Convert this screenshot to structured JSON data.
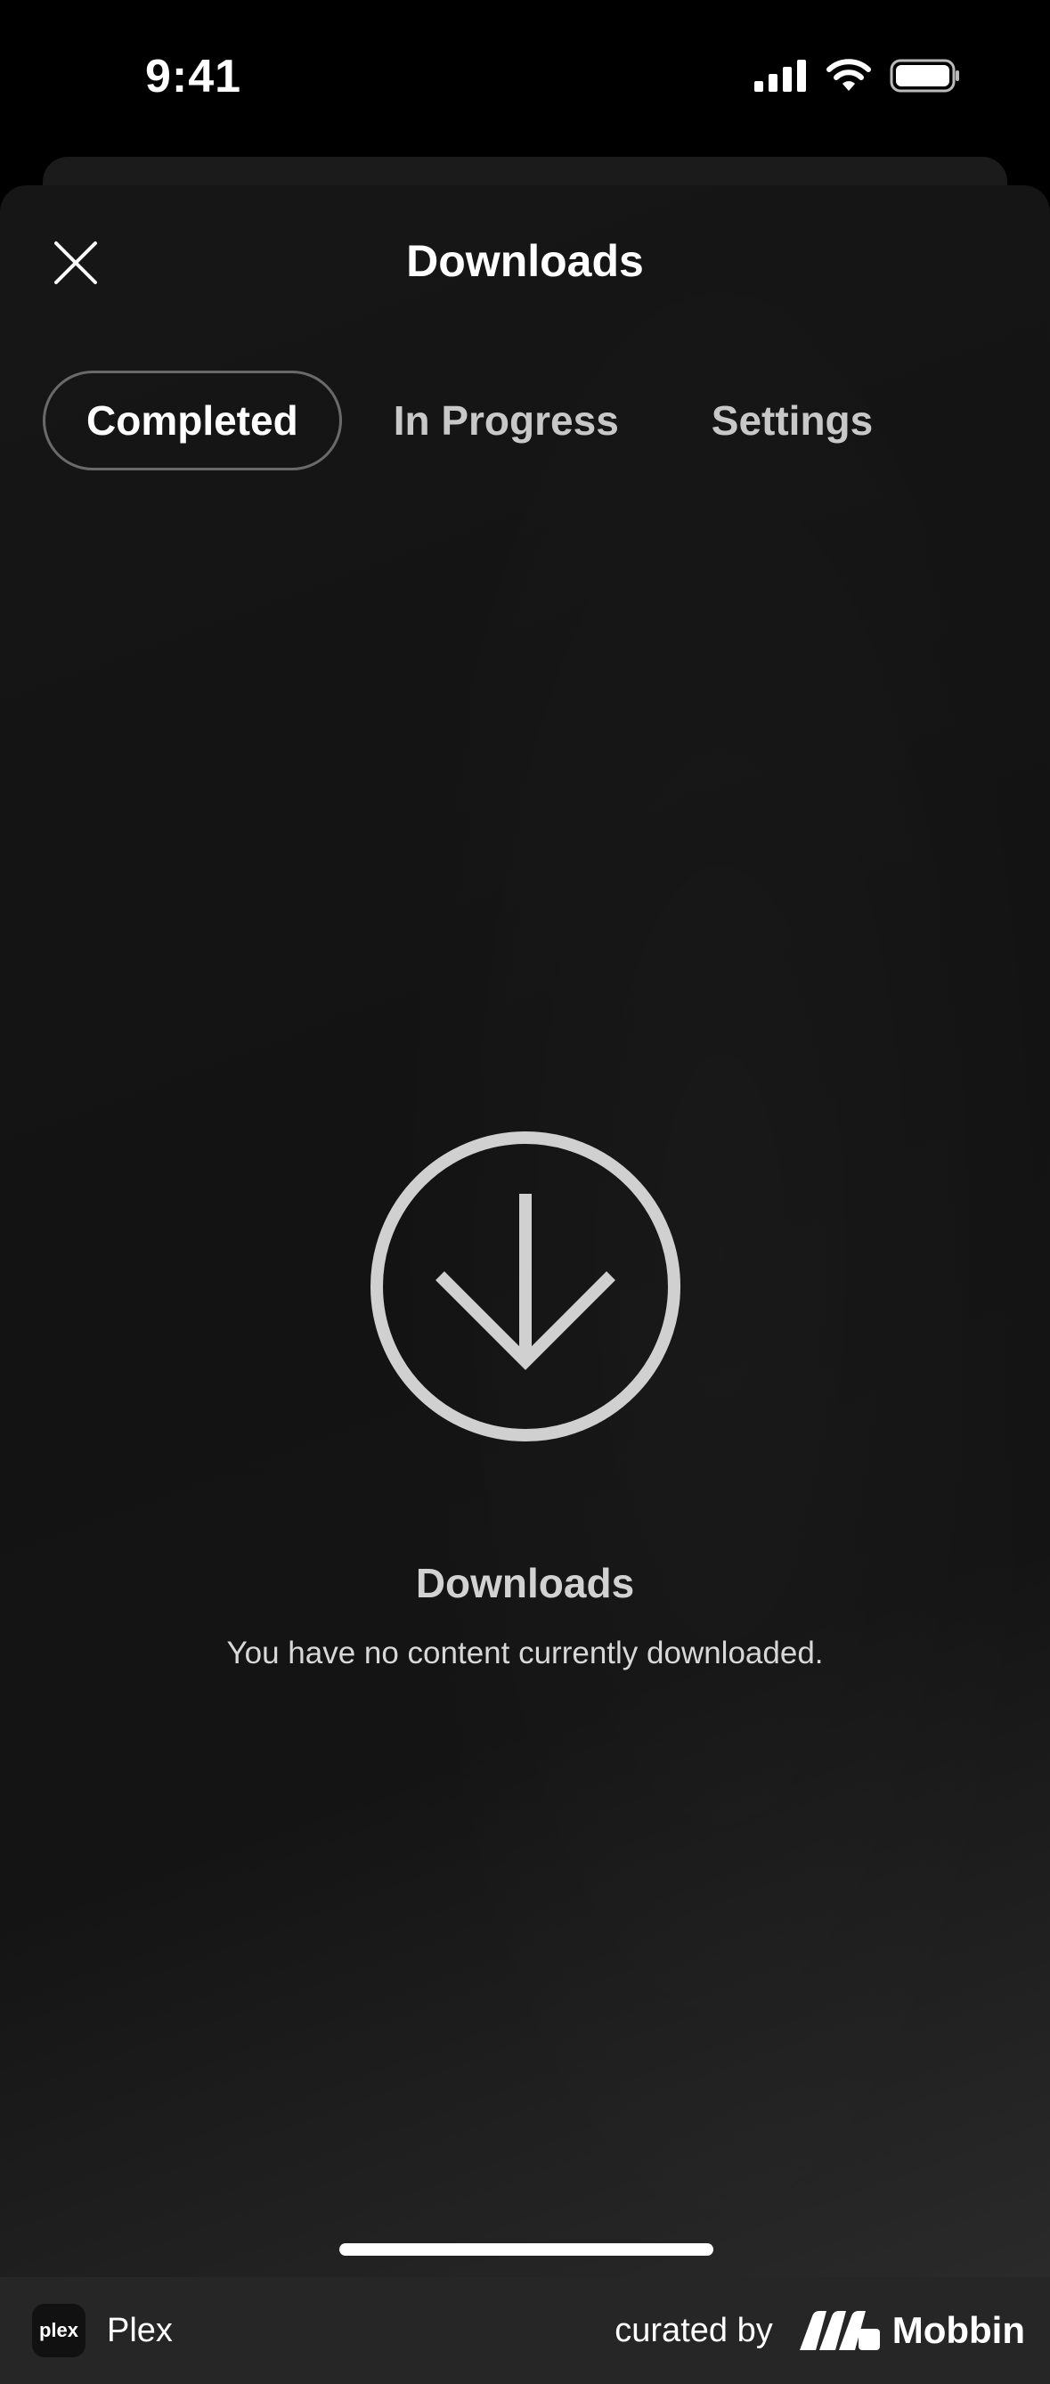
{
  "status_bar": {
    "time": "9:41"
  },
  "header": {
    "title": "Downloads"
  },
  "tabs": [
    {
      "label": "Completed",
      "active": true
    },
    {
      "label": "In Progress",
      "active": false
    },
    {
      "label": "Settings",
      "active": false
    }
  ],
  "empty_state": {
    "title": "Downloads",
    "message": "You have no content currently downloaded."
  },
  "footer": {
    "app_name": "Plex",
    "logo_text": "plex",
    "curated_label": "curated by",
    "brand": "Mobbin"
  },
  "colors": {
    "background": "#000000",
    "sheet": "#141414",
    "icon_gray": "#d0d0d0",
    "plex_accent": "#e5a00d"
  }
}
